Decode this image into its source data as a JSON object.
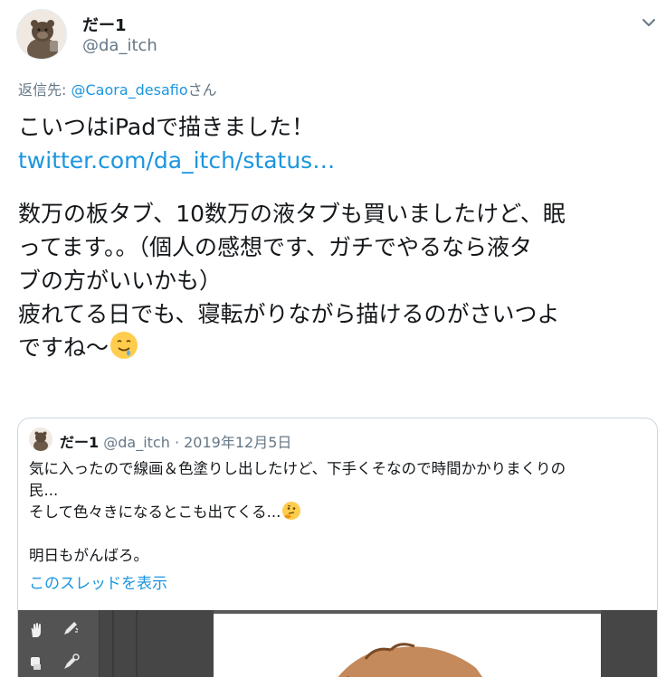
{
  "author": {
    "display_name": "だー1",
    "handle": "@da_itch"
  },
  "icons": {
    "caret": "chevron-down-icon",
    "emoji_drooling": "drooling-face-emoji",
    "emoji_thinking": "thinking-face-emoji"
  },
  "reply": {
    "prefix": "返信先: ",
    "mention": "@Caora_desafio",
    "suffix": "さん"
  },
  "tweet": {
    "line1": "こいつはiPadで描きました！",
    "link": "twitter.com/da_itch/status…",
    "line2": "数万の板タブ、10数万の液タブも買いましたけど、眠",
    "line3": "ってます。。（個人の感想です、ガチでやるなら液タ",
    "line4": "ブの方がいいかも）",
    "line5": "疲れてる日でも、寝転がりながら描けるのがさいつよ",
    "line6": "ですね〜"
  },
  "quoted": {
    "display_name": "だー1",
    "handle": "@da_itch",
    "separator": " · ",
    "date": "2019年12月5日",
    "line1": "気に入ったので線画＆色塗りし出したけど、下手くそなので時間かかりまくりの",
    "line2": "民...",
    "line3": "そして色々きになるとこも出てくる...",
    "line4": "明日もがんばろ。",
    "thread_link": "このスレッドを表示"
  },
  "colors": {
    "link": "#1b95e0",
    "secondary_text": "#657786",
    "primary_text": "#14171a",
    "border": "#ccd6dd",
    "app_dark": "#535353"
  }
}
